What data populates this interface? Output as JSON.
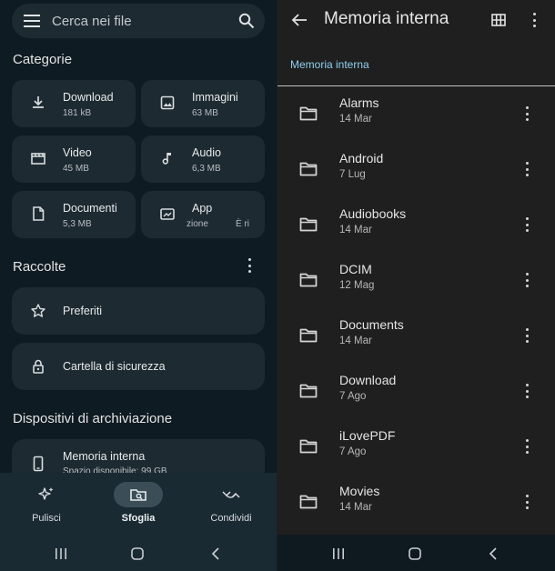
{
  "left": {
    "search": {
      "placeholder": "Cerca nei file"
    },
    "categories_title": "Categorie",
    "categories": [
      {
        "name": "Download",
        "meta": "181 kB",
        "icon": "download-icon"
      },
      {
        "name": "Immagini",
        "meta": "63 MB",
        "icon": "image-icon"
      },
      {
        "name": "Video",
        "meta": "45 MB",
        "icon": "video-icon"
      },
      {
        "name": "Audio",
        "meta": "6,3 MB",
        "icon": "music-note-icon"
      },
      {
        "name": "Documenti",
        "meta": "5,3 MB",
        "icon": "document-icon"
      },
      {
        "name": "App",
        "meta": "zione",
        "meta2": "È ri",
        "icon": "app-icon"
      }
    ],
    "collections_title": "Raccolte",
    "collections": [
      {
        "name": "Preferiti",
        "icon": "star-icon"
      },
      {
        "name": "Cartella di sicurezza",
        "icon": "lock-icon"
      }
    ],
    "storage_title": "Dispositivi di archiviazione",
    "storage": {
      "name": "Memoria interna",
      "meta": "Spazio disponibile: 99 GB",
      "icon": "phone-icon"
    },
    "bottom_nav": [
      {
        "label": "Pulisci",
        "icon": "sparkle-icon",
        "active": false
      },
      {
        "label": "Sfoglia",
        "icon": "browse-icon",
        "active": true
      },
      {
        "label": "Condividi",
        "icon": "share-icon",
        "active": false
      }
    ]
  },
  "right": {
    "title": "Memoria interna",
    "breadcrumb": "Memoria interna",
    "folders": [
      {
        "name": "Alarms",
        "date": "14 Mar"
      },
      {
        "name": "Android",
        "date": "7 Lug"
      },
      {
        "name": "Audiobooks",
        "date": "14 Mar"
      },
      {
        "name": "DCIM",
        "date": "12 Mag"
      },
      {
        "name": "Documents",
        "date": "14 Mar"
      },
      {
        "name": "Download",
        "date": "7 Ago"
      },
      {
        "name": "iLovePDF",
        "date": "7 Ago"
      },
      {
        "name": "Movies",
        "date": "14 Mar"
      }
    ]
  },
  "colors": {
    "accent": "#8ed0ef",
    "left_bg": "#0f1b22",
    "card_bg": "#1d2a31",
    "right_bg": "#1f1f1f"
  }
}
